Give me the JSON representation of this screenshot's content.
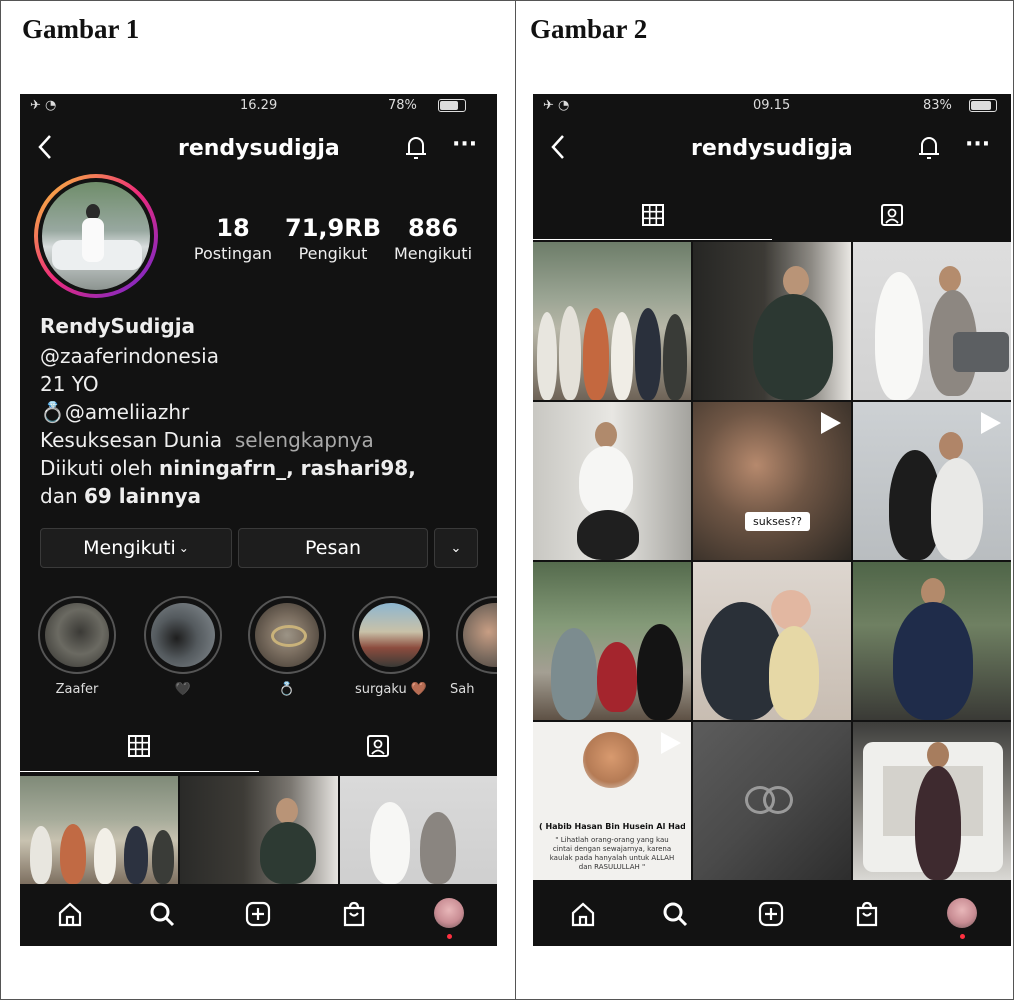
{
  "captions": {
    "left": "Gambar 1",
    "right": "Gambar 2"
  },
  "colors": {
    "background": "#121212",
    "accent": "#ff3040",
    "muted": "#a8a8a8"
  },
  "phone1": {
    "status": {
      "time": "16.29",
      "battery": "78%"
    },
    "username": "rendysudigja",
    "stats": [
      {
        "value": "18",
        "label": "Postingan"
      },
      {
        "value": "71,9RB",
        "label": "Pengikut"
      },
      {
        "value": "886",
        "label": "Mengikuti"
      }
    ],
    "bio": {
      "name": "RendySudigja",
      "line1": "@zaaferindonesia",
      "line2": "21 YO",
      "line3": "@ameliiazhr",
      "line4": "Kesuksesan Dunia",
      "more": "selengkapnya",
      "followed_prefix": "Diikuti oleh ",
      "followed_names": "niningafrn_, rashari98,",
      "followed_suffix_pre": "dan ",
      "followed_count": "69 lainnya"
    },
    "buttons": {
      "following": "Mengikuti",
      "message": "Pesan"
    },
    "highlights": [
      {
        "label": "Zaafer"
      },
      {
        "label": "🖤"
      },
      {
        "label": "💍"
      },
      {
        "label": "surgaku 🤎"
      },
      {
        "label": "Sah"
      }
    ]
  },
  "phone2": {
    "status": {
      "time": "09.15",
      "battery": "83%"
    },
    "username": "rendysudigja",
    "grid_text": {
      "sticker": "sukses??",
      "quote_title": "( Habib Hasan Bin Husein Al Haddad )",
      "quote_body": "\" Lihatlah orang-orang yang kau cintai dengan sewajarnya, karena kaulak pada hanyalah untuk ALLAH dan RASULULLAH \""
    }
  },
  "icons": {
    "back": "chevron-left-icon",
    "bell": "bell-icon",
    "more": "more-icon",
    "grid": "grid-icon",
    "tagged": "tagged-icon",
    "home": "home-icon",
    "search": "search-icon",
    "add": "add-icon",
    "shop": "shop-icon",
    "profile": "profile-avatar"
  }
}
